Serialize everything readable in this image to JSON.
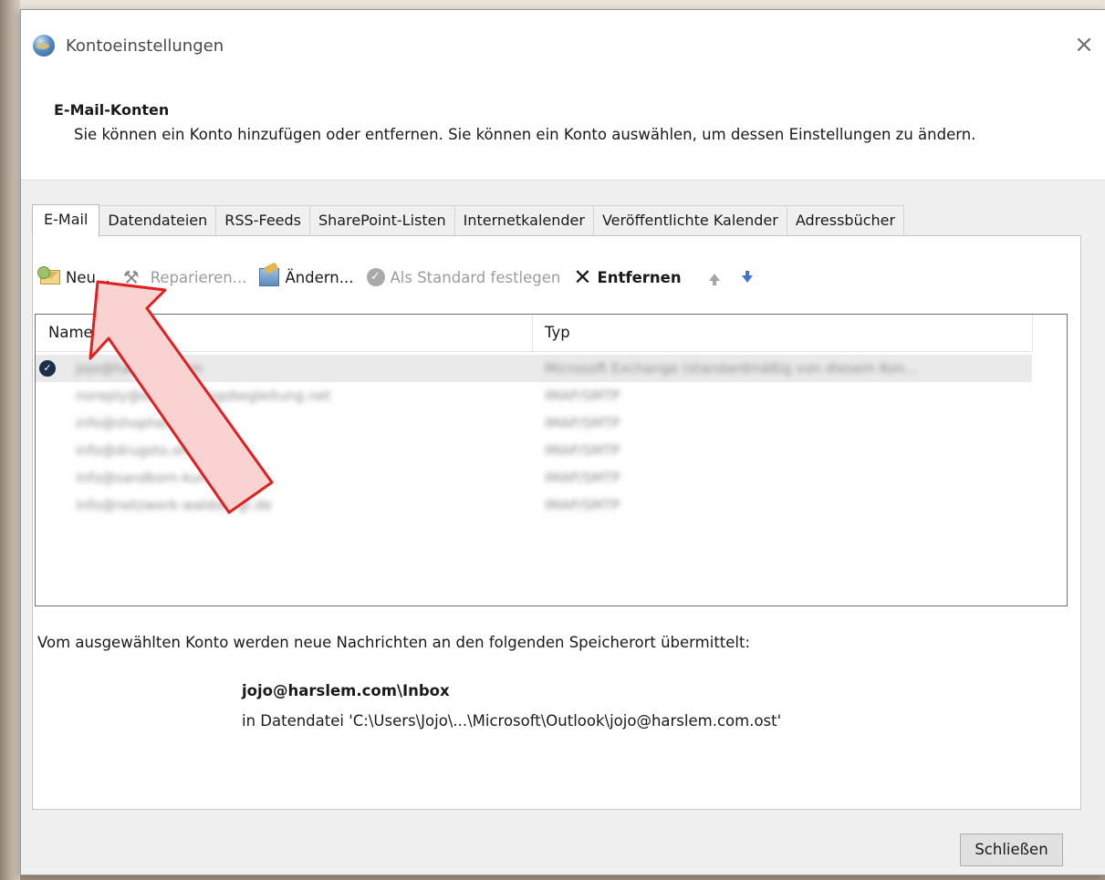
{
  "window": {
    "title": "Kontoeinstellungen",
    "close_glyph": "×"
  },
  "header": {
    "title": "E-Mail-Konten",
    "description": "Sie können ein Konto hinzufügen oder entfernen. Sie können ein Konto auswählen, um dessen Einstellungen zu ändern."
  },
  "tabs": [
    {
      "label": "E-Mail",
      "active": true
    },
    {
      "label": "Datendateien"
    },
    {
      "label": "RSS-Feeds"
    },
    {
      "label": "SharePoint-Listen"
    },
    {
      "label": "Internetkalender"
    },
    {
      "label": "Veröffentlichte Kalender"
    },
    {
      "label": "Adressbücher"
    }
  ],
  "toolbar": {
    "new_label": "Neu...",
    "repair_label": "Reparieren...",
    "change_label": "Ändern...",
    "set_default_label": "Als Standard festlegen",
    "remove_label": "Entfernen",
    "icons": [
      "new-account-icon",
      "wrench-icon",
      "change-settings-icon",
      "checkmark-icon",
      "x-icon",
      "arrow-up-icon",
      "arrow-down-icon"
    ]
  },
  "list": {
    "col_name": "Name",
    "col_type": "Typ",
    "rows": [
      {
        "name": "jojo@harslem.com",
        "type": "Microsoft Exchange (standardmäßig von diesem Kon...",
        "default": true
      },
      {
        "name": "noreply@entwicklungsbegleitung.net",
        "type": "IMAP/SMTP"
      },
      {
        "name": "info@shophelden.de",
        "type": "IMAP/SMTP"
      },
      {
        "name": "info@drugsto.shop",
        "type": "IMAP/SMTP"
      },
      {
        "name": "info@sandkorn-kunst.eu",
        "type": "IMAP/SMTP"
      },
      {
        "name": "info@netzwerk-waldorf-gl.de",
        "type": "IMAP/SMTP"
      }
    ]
  },
  "delivery": {
    "text": "Vom ausgewählten Konto werden neue Nachrichten an den folgenden Speicherort übermittelt:",
    "folder": "jojo@harslem.com\\Inbox",
    "file": "in Datendatei 'C:\\Users\\Jojo\\...\\Microsoft\\Outlook\\jojo@harslem.com.ost'"
  },
  "footer": {
    "close_label": "Schließen"
  },
  "colors": {
    "annotation_arrow_fill": "#f9d2d2",
    "annotation_arrow_stroke": "#e02020"
  }
}
